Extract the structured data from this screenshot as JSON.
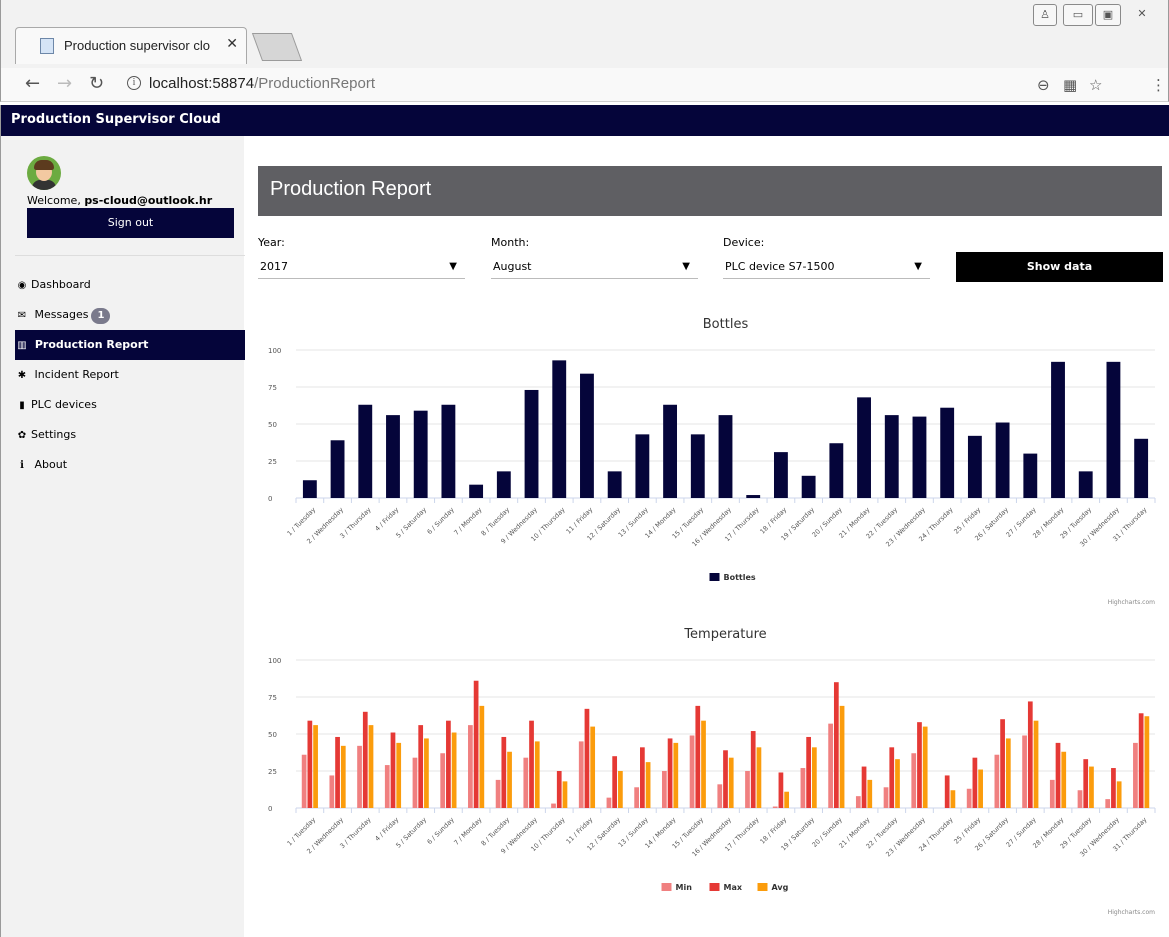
{
  "browser": {
    "tab_title": "Production supervisor clo",
    "url_host": "localhost:58874",
    "url_path": "/ProductionReport"
  },
  "app": {
    "title": "Production Supervisor Cloud"
  },
  "user": {
    "welcome_prefix": "Welcome, ",
    "email": "ps-cloud@outlook.hr",
    "signout_label": "Sign out"
  },
  "sidebar": {
    "items": [
      {
        "label": "Dashboard",
        "icon": "dashboard-icon",
        "glyph": "◉",
        "active": false
      },
      {
        "label": "Messages",
        "icon": "envelope-icon",
        "glyph": "✉",
        "active": false,
        "badge": "1"
      },
      {
        "label": "Production Report",
        "icon": "bar-chart-icon",
        "glyph": "▥",
        "active": true
      },
      {
        "label": "Incident Report",
        "icon": "bug-icon",
        "glyph": "✱",
        "active": false
      },
      {
        "label": "PLC devices",
        "icon": "device-icon",
        "glyph": "▮",
        "active": false
      },
      {
        "label": "Settings",
        "icon": "gear-icon",
        "glyph": "✿",
        "active": false
      },
      {
        "label": "About",
        "icon": "info-icon",
        "glyph": "i",
        "active": false
      }
    ]
  },
  "report": {
    "title": "Production Report",
    "year_label": "Year:",
    "year_value": "2017",
    "month_label": "Month:",
    "month_value": "August",
    "device_label": "Device:",
    "device_value": "PLC device S7-1500",
    "show_button": "Show data"
  },
  "colors": {
    "bottles": "#05053a",
    "min": "#f08080",
    "max": "#e53935",
    "avg": "#fb9c0c"
  },
  "chart_data": [
    {
      "type": "bar",
      "title": "Bottles",
      "categories": [
        "1 / Tuesday",
        "2 / Wednesday",
        "3 / Thursday",
        "4 / Friday",
        "5 / Saturday",
        "6 / Sunday",
        "7 / Monday",
        "8 / Tuesday",
        "9 / Wednesday",
        "10 / Thursday",
        "11 / Friday",
        "12 / Saturday",
        "13 / Sunday",
        "14 / Monday",
        "15 / Tuesday",
        "16 / Wednesday",
        "17 / Thursday",
        "18 / Friday",
        "19 / Saturday",
        "20 / Sunday",
        "21 / Monday",
        "22 / Tuesday",
        "23 / Wednesday",
        "24 / Thursday",
        "25 / Friday",
        "26 / Saturday",
        "27 / Sunday",
        "28 / Monday",
        "29 / Tuesday",
        "30 / Wednesday",
        "31 / Thursday"
      ],
      "series": [
        {
          "name": "Bottles",
          "values": [
            12,
            39,
            63,
            56,
            59,
            63,
            9,
            18,
            73,
            93,
            84,
            18,
            43,
            63,
            43,
            56,
            2,
            31,
            15,
            37,
            68,
            56,
            55,
            61,
            42,
            51,
            30,
            92,
            18,
            92,
            40
          ]
        }
      ],
      "ylim": [
        0,
        100
      ],
      "yticks": [
        0,
        25,
        50,
        75,
        100
      ],
      "legend": "bottom-center",
      "credit": "Highcharts.com"
    },
    {
      "type": "bar",
      "title": "Temperature",
      "categories": [
        "1 / Tuesday",
        "2 / Wednesday",
        "3 / Thursday",
        "4 / Friday",
        "5 / Saturday",
        "6 / Sunday",
        "7 / Monday",
        "8 / Tuesday",
        "9 / Wednesday",
        "10 / Thursday",
        "11 / Friday",
        "12 / Saturday",
        "13 / Sunday",
        "14 / Monday",
        "15 / Tuesday",
        "16 / Wednesday",
        "17 / Thursday",
        "18 / Friday",
        "19 / Saturday",
        "20 / Sunday",
        "21 / Monday",
        "22 / Tuesday",
        "23 / Wednesday",
        "24 / Thursday",
        "25 / Friday",
        "26 / Saturday",
        "27 / Sunday",
        "28 / Monday",
        "29 / Tuesday",
        "30 / Wednesday",
        "31 / Thursday"
      ],
      "series": [
        {
          "name": "Min",
          "values": [
            36,
            22,
            42,
            29,
            34,
            37,
            56,
            19,
            34,
            3,
            45,
            7,
            14,
            25,
            49,
            16,
            25,
            1,
            27,
            57,
            8,
            14,
            37,
            0,
            13,
            36,
            49,
            19,
            12,
            6,
            44
          ]
        },
        {
          "name": "Max",
          "values": [
            59,
            48,
            65,
            51,
            56,
            59,
            86,
            48,
            59,
            25,
            67,
            35,
            41,
            47,
            69,
            39,
            52,
            24,
            48,
            85,
            28,
            41,
            58,
            22,
            34,
            60,
            72,
            44,
            33,
            27,
            64
          ]
        },
        {
          "name": "Avg",
          "values": [
            56,
            42,
            56,
            44,
            47,
            51,
            69,
            38,
            45,
            18,
            55,
            25,
            31,
            44,
            59,
            34,
            41,
            11,
            41,
            69,
            19,
            33,
            55,
            12,
            26,
            47,
            59,
            38,
            28,
            18,
            62
          ]
        }
      ],
      "ylim": [
        0,
        100
      ],
      "yticks": [
        0,
        25,
        50,
        75,
        100
      ],
      "legend": "bottom-center",
      "credit": "Highcharts.com"
    }
  ]
}
